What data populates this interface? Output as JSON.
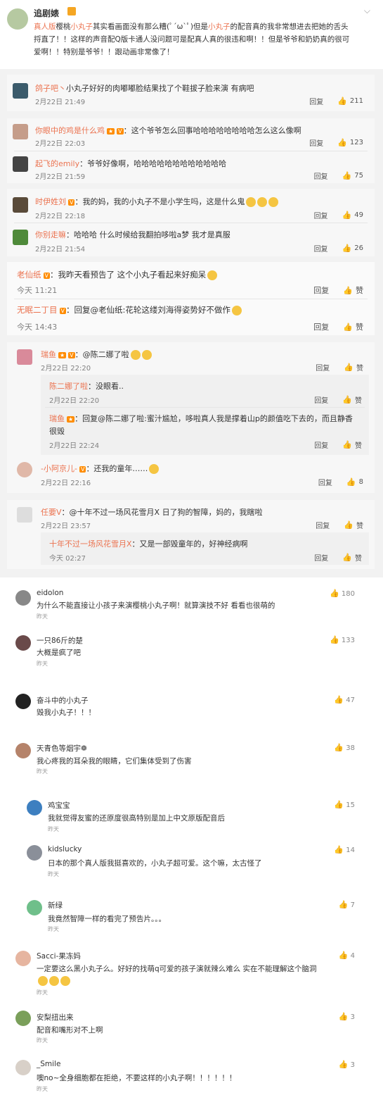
{
  "post": {
    "author": "追剧婊",
    "line1_a": "真人版",
    "line1_b": "樱桃",
    "line1_c": "小丸子",
    "line1_d": "其实看画面没有那么糟(ﾟ´ω`ﾟ)但是",
    "line1_e": "小丸子",
    "line1_f": "的配音真的我非常想进去把她的舌头",
    "line2": "捋直了！！这样的声音配Q版卡通人没问题可是配真人真的很违和啊！！但是爷爷和奶奶真的很可",
    "line3": "爱啊！！特别是爷爷！！跟动画非常像了！"
  },
  "labels": {
    "reply": "回复",
    "like": "赞"
  },
  "weibo": [
    {
      "name": "鸽子吧丶",
      "text": "小丸子好好的肉嘟嘟脸结果找了个鞋拔子脸来演 有病吧",
      "time": "2月22日 21:49",
      "likes": "211"
    },
    {
      "name": "你眼中的鸡是什么鸡",
      "text": "：这个爷爷怎么回事哈哈哈哈哈哈哈哈怎么这么像啊",
      "time": "2月22日 22:03",
      "likes": "123"
    },
    {
      "name": "起飞的emily",
      "text": "：爷爷好像啊，哈哈哈哈哈哈哈哈哈哈哈哈",
      "time": "2月22日 21:59",
      "likes": "75"
    },
    {
      "name": "时伊姓刘",
      "text": "：我的妈，我的小丸子不是小学生吗，这是什么鬼",
      "time": "2月22日 22:18",
      "likes": "49"
    },
    {
      "name": "你别走嘛",
      "text": "：哈哈哈 什么时候给我翻拍哆啦a梦 我才是真服",
      "time": "2月22日 21:54",
      "likes": "26"
    },
    {
      "name": "老仙纸",
      "text": "：我昨天看预告了 这个小丸子看起来好痴呆",
      "time": "今天 11:21",
      "likes": "赞"
    },
    {
      "name": "无眠二丁目",
      "text": "：回复@老仙纸:花轮这缕刘海得姿势好不做作",
      "time": "今天 14:43",
      "likes": "赞"
    },
    {
      "name": "瑞鱼",
      "text": "：@陈二娜了啦",
      "time": "2月22日 22:20",
      "likes": "赞"
    },
    {
      "name": "陈二娜了啦",
      "text": "：没眼看..",
      "time": "2月22日 22:20",
      "likes": "赞"
    },
    {
      "name": "瑞鱼",
      "text": "：回复@陈二娜了啦:蜜汁尴尬，哆啦真人我是撑着山p的颜值吃下去的，而且静香",
      "text2": "很毁",
      "time": "2月22日 22:24",
      "likes": "赞"
    },
    {
      "name": "-小阿京儿-",
      "text": "：还我的童年……",
      "time": "2月22日 22:16",
      "likes": "8"
    },
    {
      "name": "任要V",
      "text": "：@十年不过一场风花雪月X 日了狗的智障，妈的，我瞎啦",
      "time": "2月22日 23:57",
      "likes": "赞"
    },
    {
      "name": "十年不过一场风花雪月X",
      "text": "：又是一部毁童年的，好神经病啊",
      "time": "今天 02:27",
      "likes": "赞"
    }
  ],
  "app_comments": [
    {
      "name": "eidolon",
      "text": "为什么不能直接让小孩子来演樱桃小丸子啊！就算演技不好 看看也很萌的",
      "time": "昨天",
      "likes": "180"
    },
    {
      "name": "一只86斤的楚",
      "text": "大概是疯了吧",
      "time": "昨天",
      "likes": "133"
    },
    {
      "name": "奋斗中的小丸子",
      "text": "毁我小丸子！！！",
      "time": "昨天",
      "likes": "47"
    },
    {
      "name": "天青色等烟宇❁",
      "text": "我心疼我的耳朵我的眼睛，它们集体受到了伤害",
      "time": "昨天",
      "likes": "38"
    },
    {
      "name": "鸡宝宝",
      "text": "我就觉得友蜜的还原度很高特别是加上中文原版配音后",
      "time": "昨天",
      "likes": "15"
    },
    {
      "name": "kidslucky",
      "text": "日本的那个真人版我挺喜欢的，小丸子超可爱。这个嘛，太古怪了",
      "time": "昨天",
      "likes": "14"
    },
    {
      "name": "新绿",
      "text": "我竟然智障一样的看完了预告片。。。",
      "time": "昨天",
      "likes": "7"
    },
    {
      "name": "Sacci-果冻妈",
      "text": "一定要这么黑小丸子么。好好的找萌q可爱的孩子演就辣么难么 实在不能理解这个脑洞",
      "time": "昨天",
      "likes": "4"
    },
    {
      "name": "安梨扭出来",
      "text": "配音和嘴形对不上啊",
      "time": "昨天",
      "likes": "3"
    },
    {
      "name": "_Smile",
      "text": "噢no~全身细胞都在拒绝，不要这样的小丸子啊！！！！！！",
      "time": "昨天",
      "likes": "3"
    }
  ]
}
